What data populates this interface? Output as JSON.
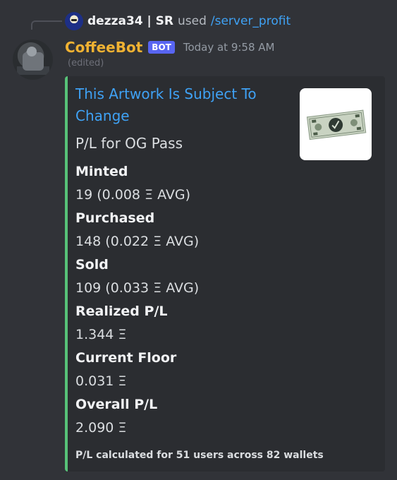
{
  "interaction": {
    "user": "dezza34 | SR",
    "used_text": "used",
    "command": "/server_profit"
  },
  "message": {
    "author": "CoffeeBot",
    "bot_tag": "BOT",
    "timestamp": "Today at 9:58 AM",
    "edited": "(edited)"
  },
  "embed": {
    "accent_color": "#57c278",
    "title": "This Artwork Is Subject To Change",
    "description": "P/L for OG Pass",
    "fields": [
      {
        "name": "Minted",
        "value": "19 (0.008 Ξ AVG)"
      },
      {
        "name": "Purchased",
        "value": "148 (0.022 Ξ AVG)"
      },
      {
        "name": "Sold",
        "value": "109 (0.033 Ξ AVG)"
      },
      {
        "name": "Realized P/L",
        "value": "1.344 Ξ"
      },
      {
        "name": "Current Floor",
        "value": "0.031 Ξ"
      },
      {
        "name": "Overall P/L",
        "value": "2.090 Ξ"
      }
    ],
    "footer": "P/L calculated for 51 users across 82 wallets"
  },
  "colors": {
    "background": "#313338",
    "embed_background": "#2b2d31",
    "link": "#3fa2f5",
    "bot_name": "#f0b232",
    "bot_tag": "#5865f2"
  }
}
